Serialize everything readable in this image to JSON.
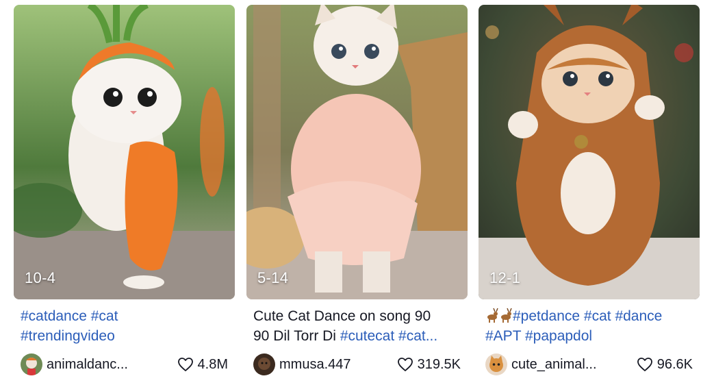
{
  "videos": [
    {
      "date": "10-4",
      "caption_lines": [
        [
          {
            "text": "#catdance #cat",
            "tag": true
          }
        ],
        [
          {
            "text": "#trendingvideo",
            "tag": true
          }
        ]
      ],
      "author": "animaldanc...",
      "likes": "4.8M"
    },
    {
      "date": "5-14",
      "caption_lines": [
        [
          {
            "text": "Cute Cat Dance on song 90",
            "tag": false
          }
        ],
        [
          {
            "text": "90 Dil Torr Di ",
            "tag": false
          },
          {
            "text": "#cutecat #cat...",
            "tag": true
          }
        ]
      ],
      "author": "mmusa.447",
      "likes": "319.5K"
    },
    {
      "date": "12-1",
      "caption_lines": [
        [
          {
            "text": "#petdance #cat #dance",
            "tag": true
          }
        ],
        [
          {
            "text": "#APT #papapdol",
            "tag": true
          }
        ]
      ],
      "caption_prefix_icon": "reindeer-emoji-icon",
      "author": "cute_animal...",
      "likes": "96.6K"
    }
  ],
  "icons": {
    "like": "heart-outline-icon"
  },
  "colors": {
    "hashtag": "#2b5db9",
    "text": "#161823"
  }
}
